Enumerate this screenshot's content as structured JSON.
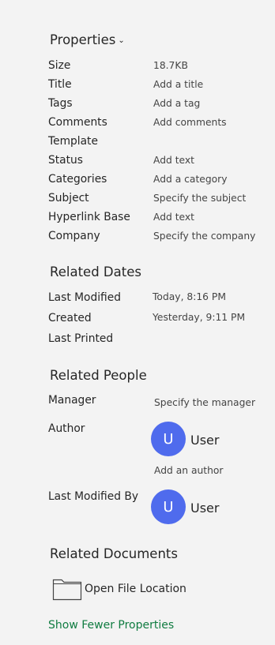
{
  "properties": {
    "heading": "Properties",
    "rows": [
      {
        "label": "Size",
        "value": "18.7KB"
      },
      {
        "label": "Title",
        "value": "Add a title"
      },
      {
        "label": "Tags",
        "value": "Add a tag"
      },
      {
        "label": "Comments",
        "value": "Add comments"
      },
      {
        "label": "Template",
        "value": ""
      },
      {
        "label": "Status",
        "value": "Add text"
      },
      {
        "label": "Categories",
        "value": "Add a category"
      },
      {
        "label": "Subject",
        "value": "Specify the subject"
      },
      {
        "label": "Hyperlink Base",
        "value": "Add text"
      },
      {
        "label": "Company",
        "value": "Specify the company"
      }
    ]
  },
  "related_dates": {
    "heading": "Related Dates",
    "rows": [
      {
        "label": "Last Modified",
        "value": "Today, 8:16 PM"
      },
      {
        "label": "Created",
        "value": "Yesterday, 9:11 PM"
      },
      {
        "label": "Last Printed",
        "value": ""
      }
    ]
  },
  "related_people": {
    "heading": "Related People",
    "manager_label": "Manager",
    "manager_value": "Specify the manager",
    "author_label": "Author",
    "author_initial": "U",
    "author_name": "User",
    "add_author": "Add an author",
    "last_modified_by_label": "Last Modified By",
    "last_modified_by_initial": "U",
    "last_modified_by_name": "User"
  },
  "related_documents": {
    "heading": "Related Documents",
    "open_file_location": "Open File Location"
  },
  "show_fewer": "Show Fewer Properties",
  "colors": {
    "accent_green": "#107c41",
    "avatar_blue": "#4f6bed"
  }
}
